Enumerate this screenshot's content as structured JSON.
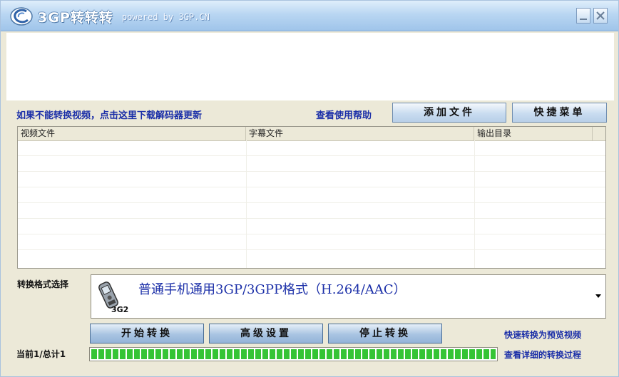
{
  "window": {
    "title": "3GP转转转",
    "subtitle": "powered by 3GP.CN"
  },
  "links": {
    "download_decoder": "如果不能转换视频，点击这里下载解码器更新",
    "help": "查看使用帮助",
    "fast_preview": "快速转换为预览视频",
    "view_details": "查看详细的转换过程"
  },
  "buttons": {
    "add_file": "添加文件",
    "shortcut_menu": "快捷菜单",
    "start": "开始转换",
    "advanced": "高级设置",
    "stop": "停止转换"
  },
  "file_list": {
    "columns": [
      "视频文件",
      "字幕文件",
      "输出目录"
    ],
    "rows": []
  },
  "format": {
    "label": "转换格式选择",
    "selected": "普通手机通用3GP/3GPP格式（H.264/AAC）",
    "badge": "3G2"
  },
  "progress": {
    "label": "当前1/总计1",
    "fraction": 1.0
  },
  "colors": {
    "link": "#1b2fa8",
    "progress": "#35c435"
  }
}
